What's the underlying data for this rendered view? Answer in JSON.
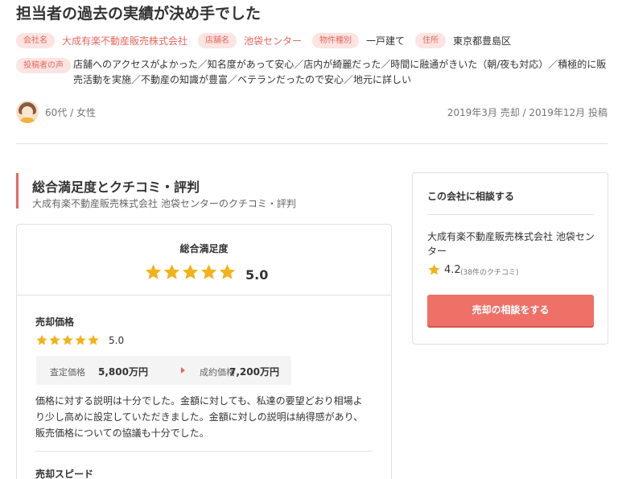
{
  "title": "担当者の過去の実績が決め手でした",
  "tags": {
    "company_label": "会社名",
    "company_value": "大成有楽不動産販売株式会社",
    "store_label": "店舗名",
    "store_value": "池袋センター",
    "property_label": "物件種別",
    "property_value": "一戸建て",
    "address_label": "住所",
    "address_value": "東京都豊島区"
  },
  "voice": {
    "label": "投稿者の声",
    "text": "店舗へのアクセスがよかった／知名度があって安心／店内が綺麗だった／時間に融通がきいた（朝/夜も対応）／積極的に販売活動を実施／不動産の知識が豊富／ベテランだったので安心／地元に詳しい"
  },
  "poster": {
    "who": "60代 / 女性",
    "posted": "2019年3月 売却 / 2019年12月 投稿"
  },
  "section": {
    "title": "総合満足度とクチコミ・評判",
    "subtitle": "大成有楽不動産販売株式会社 池袋センターのクチコミ・評判"
  },
  "overall": {
    "label": "総合満足度",
    "score": "5.0",
    "rating": 5
  },
  "sale_price": {
    "title": "売却価格",
    "score": "5.0",
    "rating": 5,
    "assess_label": "査定価格",
    "assess_value": "5,800万円",
    "deal_label": "成約価格",
    "deal_value": "7,200万円",
    "description": "価格に対する説明は十分でした。金額に対しても、私達の要望どおり相場より少し高めに設定していただきました。金額に対しの説明は納得感があり、販売価格についての協議も十分でした。"
  },
  "sale_speed": {
    "title": "売却スピード"
  },
  "sidebar": {
    "title": "この会社に相談する",
    "company": "大成有楽不動産販売株式会社 池袋センター",
    "score": "4.2",
    "count": "(38件のクチコミ)",
    "button": "売却の相談をする"
  },
  "colors": {
    "accent": "#e8675f",
    "star": "#f2b21b",
    "tag_bg": "#fbe4e1",
    "button": "#ee7067"
  }
}
